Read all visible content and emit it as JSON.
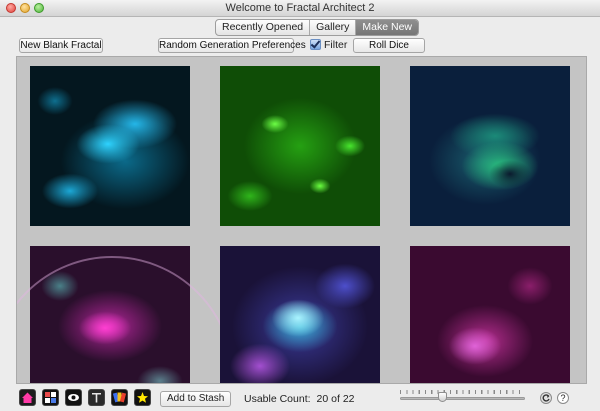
{
  "window": {
    "title": "Welcome to Fractal Architect 2"
  },
  "tabs": [
    {
      "label": "Recently Opened",
      "active": false
    },
    {
      "label": "Gallery",
      "active": false
    },
    {
      "label": "Make New",
      "active": true
    }
  ],
  "toolbar": {
    "new_blank_label": "New Blank Fractal",
    "random_prefs_label": "Random Generation Preferences",
    "filter_label": "Filter",
    "filter_checked": true,
    "roll_dice_label": "Roll Dice"
  },
  "thumbnails": [
    {
      "name": "fractal-thumbnail-cyan",
      "dominant_color": "#2ed3ff"
    },
    {
      "name": "fractal-thumbnail-green",
      "dominant_color": "#4fe02e"
    },
    {
      "name": "fractal-thumbnail-teal-navy",
      "dominant_color": "#29c07f"
    },
    {
      "name": "fractal-thumbnail-magenta-circle",
      "dominant_color": "#ff3fd2"
    },
    {
      "name": "fractal-thumbnail-blue-cyan",
      "dominant_color": "#38b5d6"
    },
    {
      "name": "fractal-thumbnail-magenta",
      "dominant_color": "#e063d8"
    }
  ],
  "bottom": {
    "icons": [
      "home-icon",
      "gallery-grid-icon",
      "eye-icon",
      "text-icon",
      "color-palette-icon",
      "star-icon"
    ],
    "stash_label": "Add to Stash",
    "usable_count_label": "Usable Count:",
    "usable_count_value": "20 of 22",
    "slider_value": 0.33,
    "help_label": "?"
  }
}
